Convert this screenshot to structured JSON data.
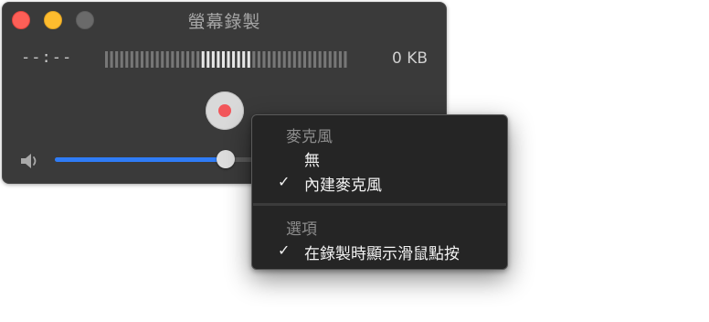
{
  "window": {
    "title": "螢幕錄製",
    "elapsed_time": "--:--",
    "file_size": "0 KB",
    "audio_level_segments": 48,
    "audio_level_active_start": 19,
    "audio_level_active_end": 28,
    "volume_fraction": 0.78,
    "record_color": "#f2565a",
    "accent_color": "#2f7cf6"
  },
  "menu": {
    "sections": [
      {
        "header": "麥克風",
        "items": [
          {
            "label": "無",
            "checked": false
          },
          {
            "label": "內建麥克風",
            "checked": true
          }
        ]
      },
      {
        "header": "選項",
        "items": [
          {
            "label": "在錄製時顯示滑鼠點按",
            "checked": true
          }
        ]
      }
    ],
    "checkmark": "✓"
  }
}
